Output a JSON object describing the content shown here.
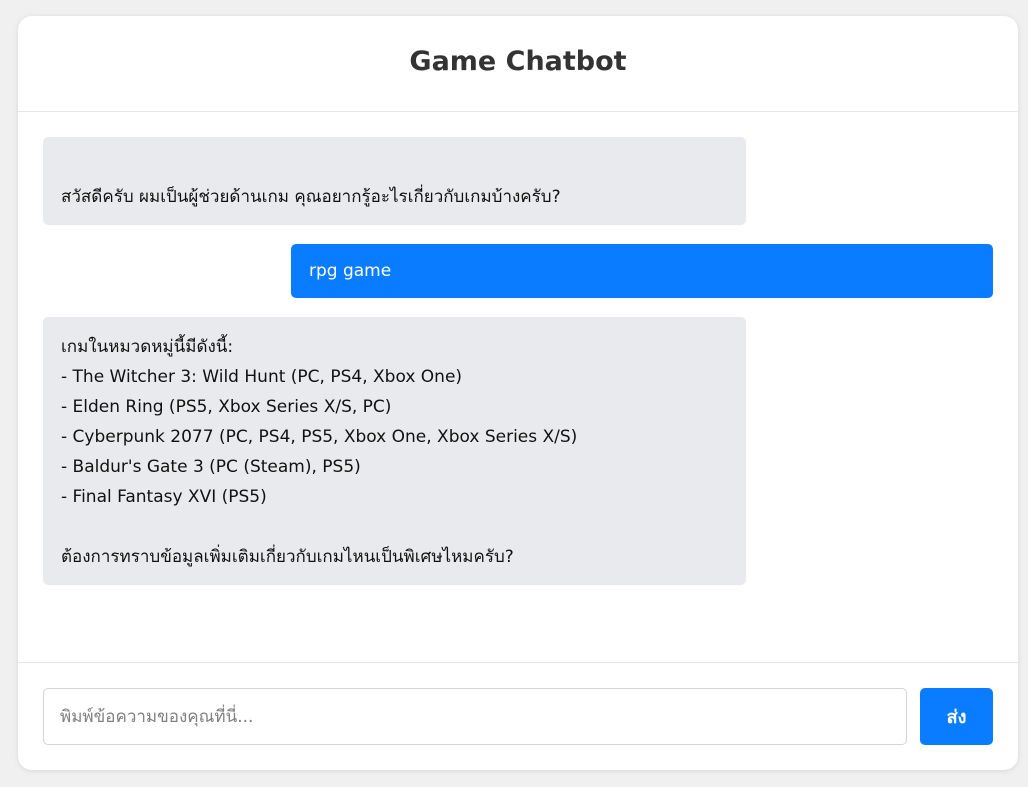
{
  "header": {
    "title": "Game Chatbot"
  },
  "messages": [
    {
      "role": "bot",
      "text": "\nสวัสดีครับ ผมเป็นผู้ช่วยด้านเกม คุณอยากรู้อะไรเกี่ยวกับเกมบ้างครับ?"
    },
    {
      "role": "user",
      "text": "rpg game"
    },
    {
      "role": "bot",
      "text": "เกมในหมวดหมู่นี้มีดังนี้:\n- The Witcher 3: Wild Hunt (PC, PS4, Xbox One)\n- Elden Ring (PS5, Xbox Series X/S, PC)\n- Cyberpunk 2077 (PC, PS4, PS5, Xbox One, Xbox Series X/S)\n- Baldur's Gate 3 (PC (Steam), PS5)\n- Final Fantasy XVI (PS5)\n\nต้องการทราบข้อมูลเพิ่มเติมเกี่ยวกับเกมไหนเป็นพิเศษไหมครับ?"
    }
  ],
  "composer": {
    "placeholder": "พิมพ์ข้อความของคุณที่นี่...",
    "value": "",
    "send_label": "ส่ง"
  },
  "colors": {
    "accent": "#0a7cff",
    "bot_bubble": "#e8eaed",
    "page_background": "#f0f0f0"
  }
}
